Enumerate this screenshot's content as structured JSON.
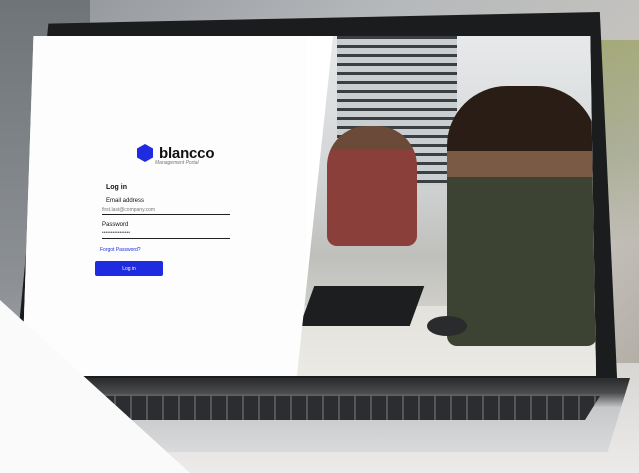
{
  "brand": {
    "name": "blancco",
    "subtitle": "Management Portal"
  },
  "form": {
    "title": "Log in",
    "email_label": "Email address",
    "email_placeholder": "first.last@company.com",
    "password_label": "Password",
    "password_value": "••••••••••••••••",
    "forgot_link": "Forgot Password?",
    "login_button": "Log in"
  },
  "colors": {
    "accent": "#1e2be0"
  },
  "icons": {
    "logo": "blancco-logo-icon"
  }
}
